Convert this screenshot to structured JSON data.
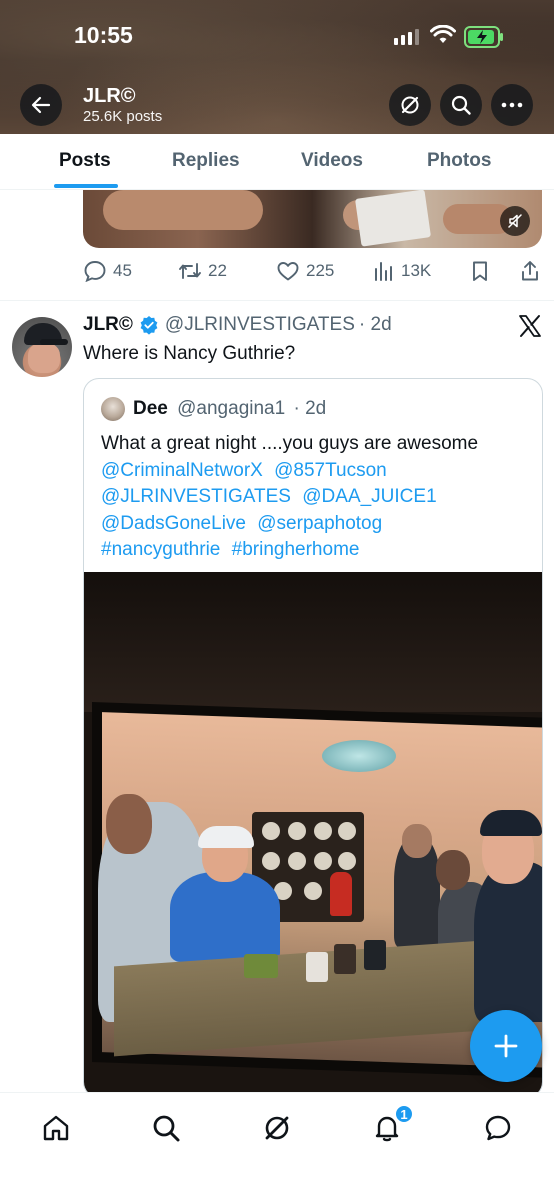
{
  "status_bar": {
    "time": "10:55"
  },
  "header": {
    "name": "JLR©",
    "post_count": "25.6K posts"
  },
  "tabs": [
    {
      "label": "Posts",
      "active": true
    },
    {
      "label": "Replies",
      "active": false
    },
    {
      "label": "Videos",
      "active": false
    },
    {
      "label": "Photos",
      "active": false
    }
  ],
  "previous_post": {
    "stats": {
      "replies": "45",
      "reposts": "22",
      "likes": "225",
      "views": "13K"
    }
  },
  "post": {
    "display_name": "JLR©",
    "handle": "@JLRINVESTIGATES",
    "time": "· 2d",
    "text": "Where is Nancy Guthrie?",
    "quote": {
      "display_name": "Dee",
      "handle": "@angagina1",
      "time": "· 2d",
      "text_intro": "What a great night ....you guys are awesome",
      "mentions_line1": [
        "@CriminalNetworX",
        "@857Tucson"
      ],
      "mentions_line2": [
        "@JLRINVESTIGATES",
        "@DAA_JUICE1"
      ],
      "mentions_line3": [
        "@DadsGoneLive",
        "@serpaphotog"
      ],
      "hashtags": [
        "#nancyguthrie",
        "#bringherhome"
      ]
    }
  },
  "bottom_nav": {
    "notification_badge": "1"
  },
  "colors": {
    "accent": "#1d9bf0",
    "text": "#0f1419",
    "muted": "#536471",
    "border": "#cfd9de"
  }
}
